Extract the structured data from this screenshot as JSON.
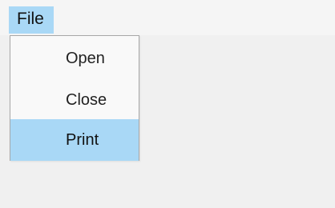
{
  "menubar": {
    "title": "File"
  },
  "dropdown": {
    "items": [
      {
        "label": "Open",
        "state": "normal"
      },
      {
        "label": "Close",
        "state": "normal"
      },
      {
        "label": "Print",
        "state": "highlighted"
      }
    ]
  },
  "colors": {
    "background": "#f0f0f0",
    "menubar_background": "#f5f5f5",
    "highlight": "#a9d8f6",
    "menu_background": "#f9f9f9",
    "menu_border": "#a7a7a7",
    "text": "#222222"
  }
}
